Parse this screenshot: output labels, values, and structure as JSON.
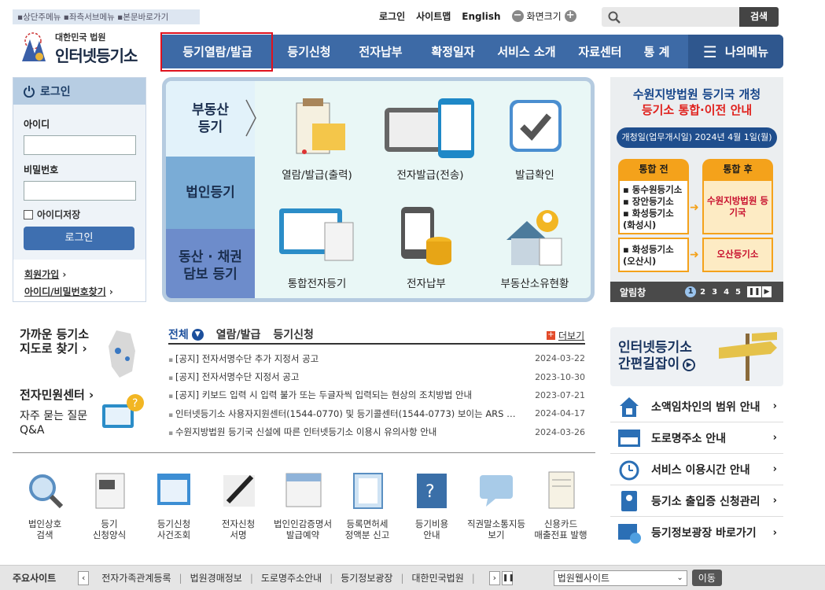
{
  "topbar": {
    "skip_links": "▪상단주메뉴 ▪좌측서브메뉴 ▪본문바로가기",
    "login": "로그인",
    "sitemap": "사이트맵",
    "english": "English",
    "font_size": "화면크기",
    "minus": "−",
    "plus": "+",
    "search_placeholder": "",
    "search_btn": "검색"
  },
  "logo": {
    "sub": "대한민국 법원",
    "title": "인터넷등기소"
  },
  "gnb": [
    "등기열람/발급",
    "등기신청",
    "전자납부",
    "확정일자",
    "서비스 소개",
    "자료센터",
    "통 계"
  ],
  "my_menu": "나의메뉴",
  "login": {
    "title": "로그인",
    "id_label": "아이디",
    "pw_label": "비밀번호",
    "save_id": "아이디저장",
    "button": "로그인",
    "join": "회원가입",
    "find": "아이디/비밀번호찾기"
  },
  "panel": {
    "tabs": [
      "부동산\n등기",
      "법인등기",
      "동산 · 채권\n담보 등기"
    ],
    "services": [
      "열람/발급(출력)",
      "전자발급(전송)",
      "발급확인",
      "통합전자등기",
      "전자납부",
      "부동산소유현황"
    ]
  },
  "banner": {
    "title1": "수원지방법원 등기국 개청",
    "title2": "등기소 통합·이전 안내",
    "date": "개청일(업무개시일) 2024년 4월 1일(월)",
    "before": "통합 전",
    "after": "통합 후",
    "before_list": [
      "▪ 동수원등기소",
      "▪ 장안등기소",
      "▪ 화성등기소 (화성시)"
    ],
    "before_list2": [
      "▪ 화성등기소 (오산시)"
    ],
    "after1": "수원지방법원 등기국",
    "after2": "오산등기소",
    "bar_label": "알림창",
    "pages": [
      "1",
      "2",
      "3",
      "4",
      "5"
    ]
  },
  "quick": {
    "map": "가까운 등기소\n지도로 찾기 ›",
    "center": "전자민원센터 ›",
    "faq": "자주 묻는 질문\nQ&A"
  },
  "notice": {
    "tabs": [
      "전체",
      "열람/발급",
      "등기신청"
    ],
    "more": "더보기",
    "items": [
      {
        "title": "[공지] 전자서명수단 추가 지정서 공고",
        "date": "2024-03-22"
      },
      {
        "title": "[공지] 전자서명수단 지정서 공고",
        "date": "2023-10-30"
      },
      {
        "title": "[공지] 키보드 입력 시 입력 불가 또는 두글자씩 입력되는 현상의 조치방법 안내",
        "date": "2023-07-21"
      },
      {
        "title": "인터넷등기소 사용자지원센터(1544-0770) 및 등기콜센터(1544-0773) 보이는 ARS …",
        "date": "2024-04-17"
      },
      {
        "title": "수원지방법원 등기국 신설에 따른 인터넷등기소 이용시 유의사항 안내",
        "date": "2024-03-26"
      }
    ]
  },
  "shortcut": {
    "line1": "인터넷등기소",
    "line2": "간편길잡이"
  },
  "right_links": [
    "소액임차인의 범위 안내",
    "도로명주소 안내",
    "서비스 이용시간 안내",
    "등기소 출입증 신청관리",
    "등기정보광장 바로가기"
  ],
  "bottom_icons": [
    "법인상호\n검색",
    "등기\n신청양식",
    "등기신청\n사건조회",
    "전자신청\n서명",
    "법인인감증명서\n발급예약",
    "등록면허세\n정액분 신고",
    "등기비용\n안내",
    "직권말소통지등\n보기",
    "신용카드\n매출전표 발행"
  ],
  "footer": {
    "label": "주요사이트",
    "sites": [
      "전자가족관계등록",
      "법원경매정보",
      "도로명주소안내",
      "등기정보광장",
      "대한민국법원"
    ],
    "select": "법원웹사이트",
    "go": "이동"
  },
  "colors": {
    "gnb": "#3d6aa6",
    "highlight": "#e0121e",
    "panel_bg": "#e9f7f6",
    "tab1": "#e2f2fa",
    "tab2": "#7aacd6",
    "tab3": "#6d8ccb"
  }
}
